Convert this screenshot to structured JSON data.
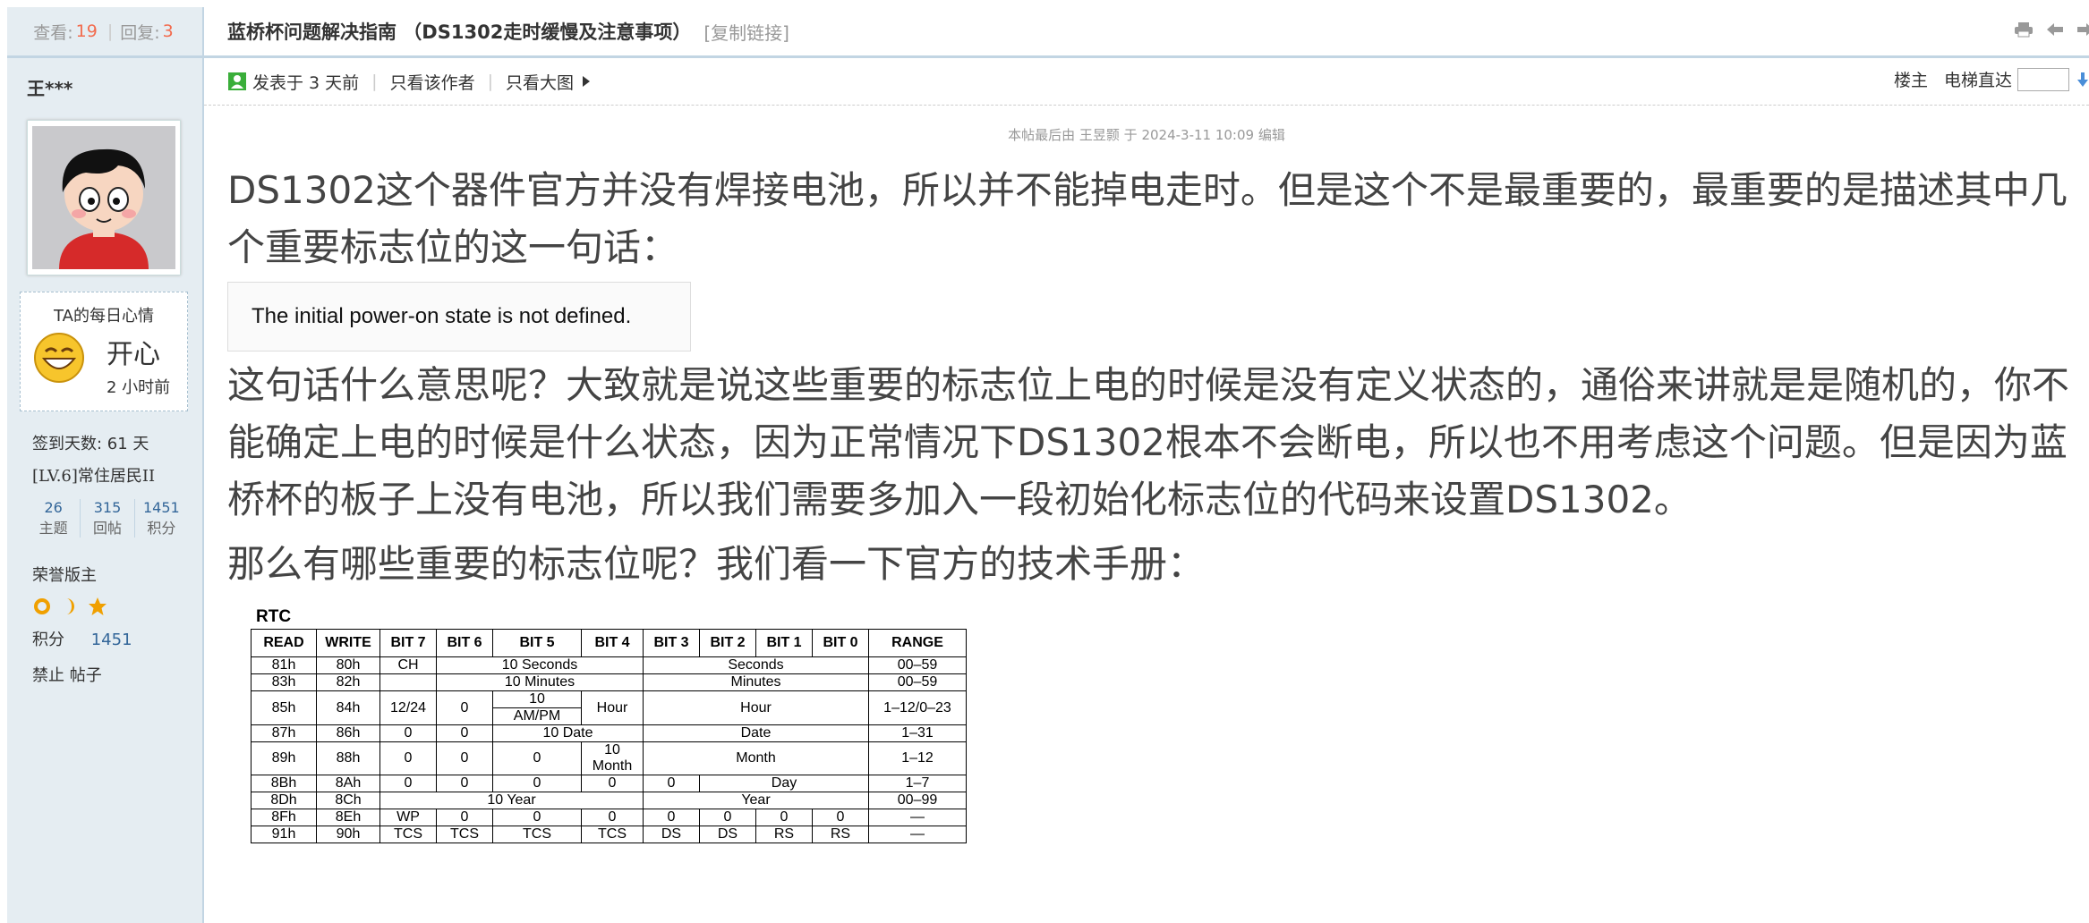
{
  "sidebar": {
    "stats": {
      "views_label": "查看:",
      "views": "19",
      "replies_label": "回复:",
      "replies": "3"
    },
    "author": "王***",
    "mood": {
      "title": "TA的每日心情",
      "text": "开心",
      "time": "2 小时前"
    },
    "sign_days": "签到天数: 61 天",
    "level": "[LV.6]常住居民II",
    "credits": [
      {
        "value": "26",
        "label": "主题"
      },
      {
        "value": "315",
        "label": "回帖"
      },
      {
        "value": "1451",
        "label": "积分"
      }
    ],
    "honor": "荣誉版主",
    "points_label": "积分",
    "points_value": "1451",
    "ban": "禁止 帖子"
  },
  "post": {
    "title": "蓝桥杯问题解决指南 （DS1302走时缓慢及注意事项）",
    "copy_link": "[复制链接]",
    "posted": "发表于 3 天前",
    "only_author": "只看该作者",
    "big_image": "只看大图",
    "floor_label": "楼主",
    "elevator_label": "电梯直达",
    "edited": "本帖最后由 王昱颢 于 2024-3-11 10:09 编辑",
    "p1": "DS1302这个器件官方并没有焊接电池，所以并不能掉电走时。但是这个不是最重要的，最重要的是描述其中几个重要标志位的这一句话：",
    "quote": "The initial power-on state is not defined.",
    "p2": "这句话什么意思呢？大致就是说这些重要的标志位上电的时候是没有定义状态的，通俗来讲就是是随机的，你不能确定上电的时候是什么状态，因为正常情况下DS1302根本不会断电，所以也不用考虑这个问题。但是因为蓝桥杯的板子上没有电池，所以我们需要多加入一段初始化标志位的代码来设置DS1302。",
    "p3": "那么有哪些重要的标志位呢？我们看一下官方的技术手册："
  },
  "rtc": {
    "title": "RTC",
    "headers": [
      "READ",
      "WRITE",
      "BIT 7",
      "BIT 6",
      "BIT 5",
      "BIT 4",
      "BIT 3",
      "BIT 2",
      "BIT 1",
      "BIT 0",
      "RANGE"
    ],
    "r1": [
      "81h",
      "80h",
      "CH",
      "10 Seconds",
      "Seconds",
      "00–59"
    ],
    "r2": [
      "83h",
      "82h",
      "10 Minutes",
      "Minutes",
      "00–59"
    ],
    "r3": [
      "85h",
      "84h",
      "12/24",
      "0",
      "10",
      "AM/PM",
      "Hour",
      "Hour",
      "1–12/0–23"
    ],
    "r4": [
      "87h",
      "86h",
      "0",
      "0",
      "10 Date",
      "Date",
      "1–31"
    ],
    "r5": [
      "89h",
      "88h",
      "0",
      "0",
      "0",
      "10",
      "Month",
      "Month",
      "1–12"
    ],
    "r6": [
      "8Bh",
      "8Ah",
      "0",
      "0",
      "0",
      "0",
      "0",
      "Day",
      "1–7"
    ],
    "r7": [
      "8Dh",
      "8Ch",
      "10 Year",
      "Year",
      "00–99"
    ],
    "r8": [
      "8Fh",
      "8Eh",
      "WP",
      "0",
      "0",
      "0",
      "0",
      "0",
      "0",
      "0",
      "—"
    ],
    "r9": [
      "91h",
      "90h",
      "TCS",
      "TCS",
      "TCS",
      "TCS",
      "DS",
      "DS",
      "RS",
      "RS",
      "—"
    ]
  }
}
